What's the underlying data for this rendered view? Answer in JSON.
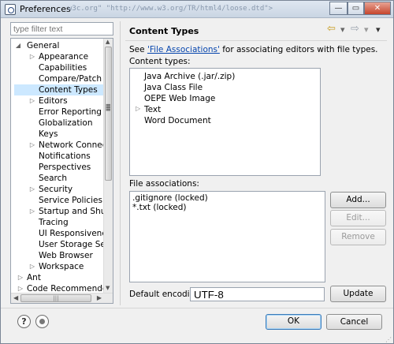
{
  "window": {
    "title": "Preferences",
    "background_ghost_text": "w3c.org\"  \"http://www.w3.org/TR/html4/loose.dtd\">",
    "minimize_glyph": "—",
    "maximize_glyph": "▭",
    "close_glyph": "✕"
  },
  "filter": {
    "placeholder": "type filter text"
  },
  "tree": {
    "general": "General",
    "children": [
      {
        "label": "Appearance",
        "expandable": true
      },
      {
        "label": "Capabilities",
        "expandable": false
      },
      {
        "label": "Compare/Patch",
        "expandable": false
      },
      {
        "label": "Content Types",
        "expandable": false,
        "selected": true
      },
      {
        "label": "Editors",
        "expandable": true
      },
      {
        "label": "Error Reporting",
        "expandable": false
      },
      {
        "label": "Globalization",
        "expandable": false
      },
      {
        "label": "Keys",
        "expandable": false
      },
      {
        "label": "Network Connectio",
        "expandable": true
      },
      {
        "label": "Notifications",
        "expandable": false
      },
      {
        "label": "Perspectives",
        "expandable": false
      },
      {
        "label": "Search",
        "expandable": false
      },
      {
        "label": "Security",
        "expandable": true
      },
      {
        "label": "Service Policies",
        "expandable": false
      },
      {
        "label": "Startup and Shutdo",
        "expandable": true
      },
      {
        "label": "Tracing",
        "expandable": false
      },
      {
        "label": "UI Responsiveness N",
        "expandable": false
      },
      {
        "label": "User Storage Servic",
        "expandable": false
      },
      {
        "label": "Web Browser",
        "expandable": false
      },
      {
        "label": "Workspace",
        "expandable": true
      }
    ],
    "root_items": [
      {
        "label": "Ant",
        "expandable": true
      },
      {
        "label": "Code Recommenders",
        "expandable": true
      }
    ]
  },
  "page": {
    "title": "Content Types",
    "see_prefix": "See ",
    "see_link": "'File Associations'",
    "see_suffix": " for associating editors with file types.",
    "content_types_label": "Content types:",
    "content_types": [
      "Java Archive (.jar/.zip)",
      "Java Class File",
      "OEPE Web Image",
      "Text",
      "Word Document"
    ],
    "file_associations_label": "File associations:",
    "file_associations": [
      ".gitignore (locked)",
      "*.txt (locked)"
    ],
    "buttons": {
      "add": "Add...",
      "edit": "Edit...",
      "remove": "Remove",
      "update": "Update"
    },
    "default_encoding_label": "Default encoding:",
    "default_encoding_value": "UTF-8"
  },
  "footer": {
    "ok": "OK",
    "cancel": "Cancel",
    "help_glyph": "?"
  },
  "colors": {
    "selection": "#cce8ff",
    "link": "#0645ad",
    "window_bg": "#f0f0f0"
  }
}
